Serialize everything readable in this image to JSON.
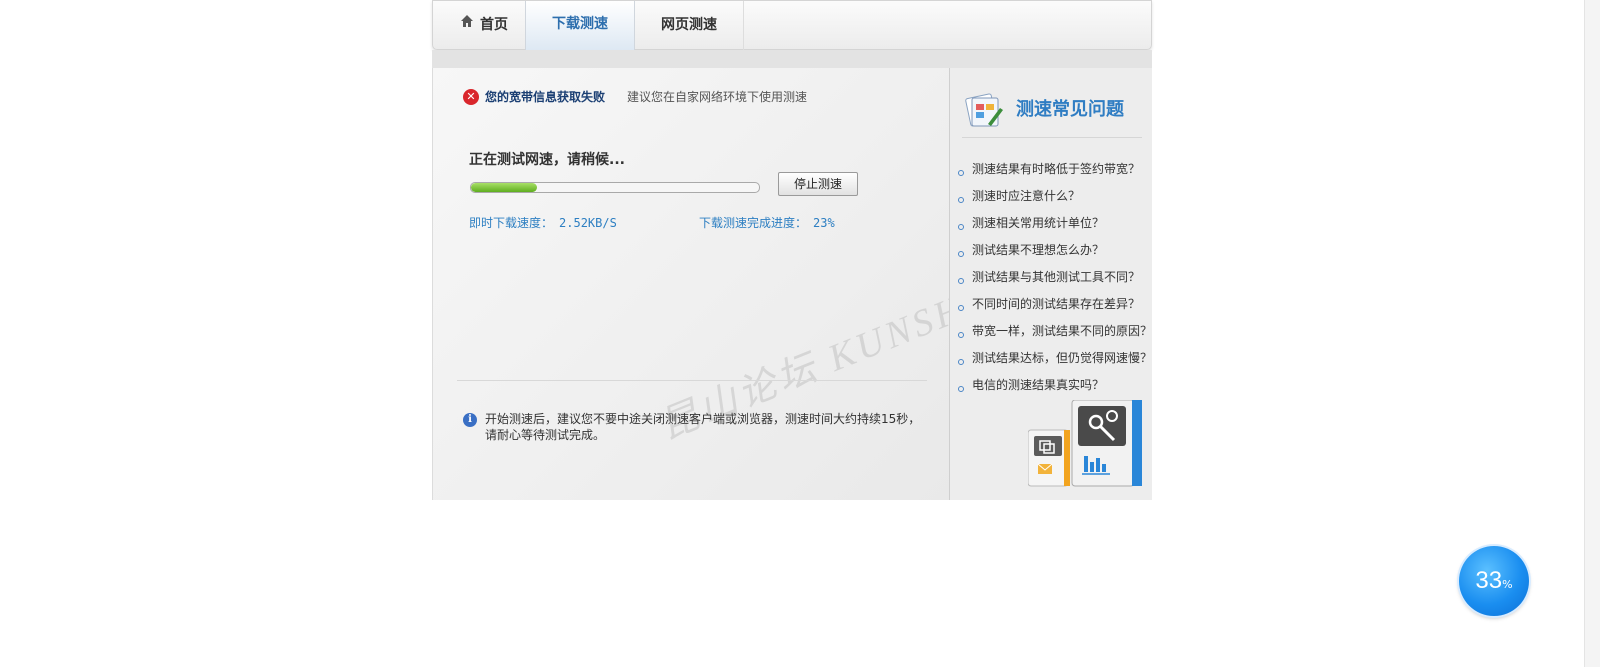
{
  "tabs": {
    "home": "首页",
    "download": "下载测速",
    "web": "网页测速"
  },
  "status": {
    "error_title": "您的宽带信息获取失败",
    "error_hint": "建议您在自家网络环境下使用测速"
  },
  "test": {
    "testing_text": "正在测试网速，请稍候...",
    "progress": 0.23,
    "stop_label": "停止测速",
    "speed_label": "即时下载速度：",
    "speed_value": "2.52KB/S",
    "progress_label": "下载测速完成进度：",
    "progress_value": "23%"
  },
  "note": "开始测速后，建议您不要中途关闭测速客户端或浏览器，测速时间大约持续15秒，请耐心等待测试完成。",
  "watermark": "昆山论坛 KUNSHAN BBS",
  "faq": {
    "title": "测速常见问题",
    "items": [
      "测速结果有时略低于签约带宽？",
      "测速时应注意什么？",
      "测速相关常用统计单位？",
      "测试结果不理想怎么办？",
      "测试结果与其他测试工具不同？",
      "不同时间的测试结果存在差异？",
      "带宽一样，测试结果不同的原因？",
      "测试结果达标，但仍觉得网速慢？",
      "电信的测速结果真实吗？"
    ]
  },
  "badge": {
    "value": "33",
    "unit": "%"
  },
  "icons": {
    "home": "home-icon",
    "error": "error-icon",
    "info": "info-icon",
    "faq": "faq-icon",
    "tools": "tools-illustration"
  },
  "colors": {
    "accent": "#2f7dc3",
    "progress": "#6bbf2a",
    "error": "#d9262c",
    "badge": "#1a8ef0"
  }
}
